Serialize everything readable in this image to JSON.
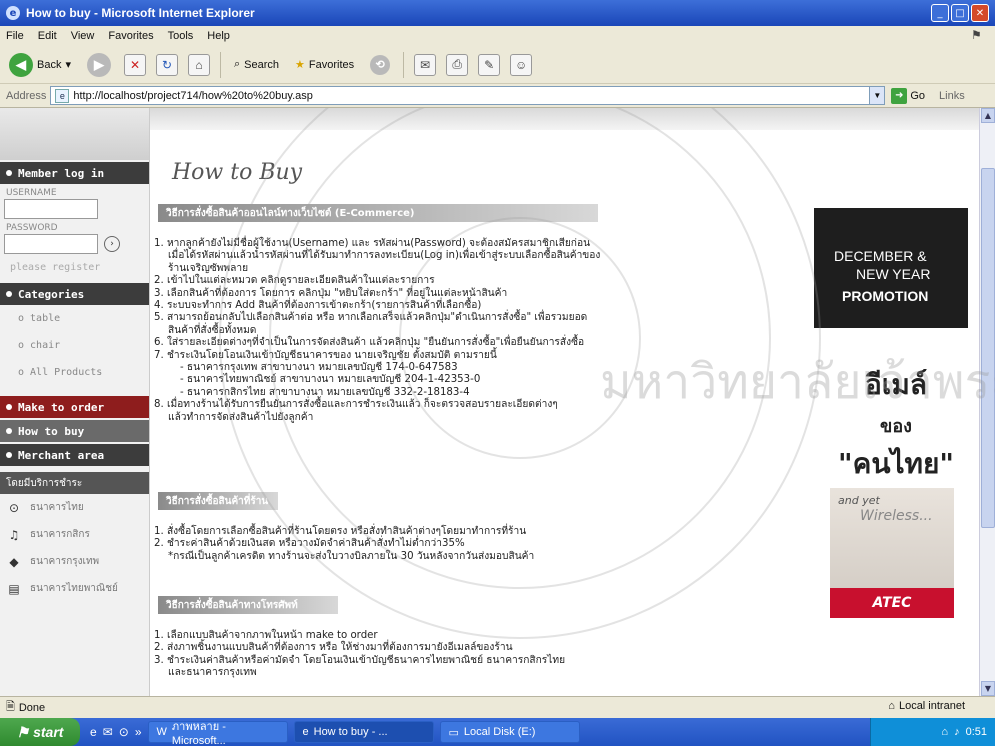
{
  "window": {
    "title": "How to buy - Microsoft Internet Explorer",
    "controls": [
      "_",
      "□",
      "✕"
    ]
  },
  "menubar": {
    "items": [
      "File",
      "Edit",
      "View",
      "Favorites",
      "Tools",
      "Help"
    ]
  },
  "toolbar": {
    "back_label": "Back",
    "search_label": "Search",
    "favorites_label": "Favorites"
  },
  "addressbar": {
    "label": "Address",
    "url": "http://localhost/project714/how%20to%20buy.asp",
    "go_label": "Go",
    "links_label": "Links"
  },
  "sidebar": {
    "member_title": "Member log in",
    "username_label": "USERNAME",
    "password_label": "PASSWORD",
    "register_link": "please register",
    "categories_title": "Categories",
    "category_items": [
      "o table",
      "o chair",
      "o All Products"
    ],
    "make_to_order": "Make to order",
    "how_to_buy": "How to buy",
    "merchant_area": "Merchant area",
    "payment_banner": "โดยมีบริการชำระ",
    "payment_items": [
      "ธนาคารไทย",
      "ธนาคารกสิกร",
      "ธนาคารกรุงเทพ",
      "ธนาคารไทยพาณิชย์"
    ]
  },
  "main": {
    "heading": "How to Buy",
    "section1_title": "วิธีการสั่งซื้อสินค้าออนไลน์ทางเว็บไซต์ (E-Commerce)",
    "section1_items": [
      "1. หากลูกค้ายังไม่มีชื่อผู้ใช้งาน(Username) และ รหัสผ่าน(Password) จะต้องสมัครสมาชิกเสียก่อน",
      "   เมื่อได้รหัสผ่านแล้วนำรหัสผ่านที่ได้รับมาทำการลงทะเบียน(Log in)เพื่อเข้าสู่ระบบเลือกซื้อสินค้าของ",
      "   ร้านเจริญซัพพลาย",
      "2. เข้าไปในแต่ละหมวด คลิกดูรายละเอียดสินค้าในแต่ละรายการ",
      "3. เลือกสินค้าที่ต้องการ โดยการ คลิกปุ่ม \"หยิบใส่ตะกร้า\" ที่อยู่ในแต่ละหน้าสินค้า",
      "4. ระบบจะทำการ Add สินค้าที่ต้องการเข้าตะกร้า(รายการสินค้าที่เลือกซื้อ)",
      "5. สามารถย้อนกลับไปเลือกสินค้าต่อ หรือ หากเลือกเสร็จแล้วคลิกปุ่ม\"ดำเนินการสั่งซื้อ\" เพื่อรวมยอด",
      "   สินค้าที่สั่งซื้อทั้งหมด",
      "6. ใส่รายละเอียดต่างๆที่จำเป็นในการจัดส่งสินค้า แล้วคลิกปุ่ม \"ยืนยันการสั่งซื้อ\"เพื่อยืนยันการสั่งซื้อ",
      "7. ชำระเงินโดยโอนเงินเข้าบัญชีธนาคารของ นายเจริญชัย ตั้งสมบัติ ตามรายนี้"
    ],
    "bank_lines": [
      "- ธนาคารกรุงเทพ       สาขาบางนา     หมายเลขบัญชี 174-0-647583",
      "- ธนาคารไทยพาณิชย์    สาขาบางนา     หมายเลขบัญชี 204-1-42353-0",
      "- ธนาคารกสิกรไทย       สาขาบางนา     หมายเลขบัญชี 332-2-18183-4"
    ],
    "section1_tail": [
      "8. เมื่อทางร้านได้รับการยืนยันการสั่งซื้อและการชำระเงินแล้ว ก็จะตรวจสอบรายละเอียดต่างๆ",
      "   แล้วทำการจัดส่งสินค้าไปยังลูกค้า"
    ],
    "section2_title": "วิธีการสั่งซื้อสินค้าที่ร้าน",
    "section2_items": [
      "1. สั่งซื้อโดยการเลือกซื้อสินค้าที่ร้านโดยตรง หรือสั่งทำสินค้าต่างๆโดยมาทำการที่ร้าน",
      "2. ชำระค่าสินค้าด้วยเงินสด หรือวางมัดจำค่าสินค้าสั่งทำไม่ต่ำกว่า35%",
      "   *กรณีเป็นลูกค้าเครดิต ทางร้านจะส่งใบวางบิลภายใน 30 วันหลังจากวันส่งมอบสินค้า"
    ],
    "section3_title": "วิธีการสั่งซื้อสินค้าทางโทรศัพท์",
    "section3_items": [
      "1. เลือกแบบสินค้าจากภาพในหน้า make to order",
      "2. ส่งภาพชิ้นงานแบบสินค้าที่ต้องการ หรือ ให้ช่างมาที่ต้องการมายังอีเมลล์ของร้าน",
      "3. ชำระเงินค่าสินค้าหรือค่ามัดจำ โดยโอนเงินเข้าบัญชีธนาคารไทยพาณิชย์ ธนาคารกสิกรไทย",
      "   และธนาคารกรุงเทพ"
    ]
  },
  "right": {
    "promo_line1": "DECEMBER &",
    "promo_line2": "NEW YEAR",
    "promo_line3": "PROMOTION",
    "email_line1": "อีเมล์",
    "email_line2": "ของ",
    "email_line3": "\"คนไทย\"",
    "atec_tag1": "and yet",
    "atec_tag2": "Wireless...",
    "atec_brand": "ATEC"
  },
  "statusbar": {
    "status": "Done",
    "zone": "Local intranet"
  },
  "taskbar": {
    "start": "start",
    "tasks": [
      "ภาพหลาย - Microsoft...",
      "How to buy - ...",
      "Local Disk (E:)"
    ],
    "clock": "0:51"
  },
  "watermark": {
    "text": "มหาวิทยาลัยเจ้าพระยา"
  }
}
